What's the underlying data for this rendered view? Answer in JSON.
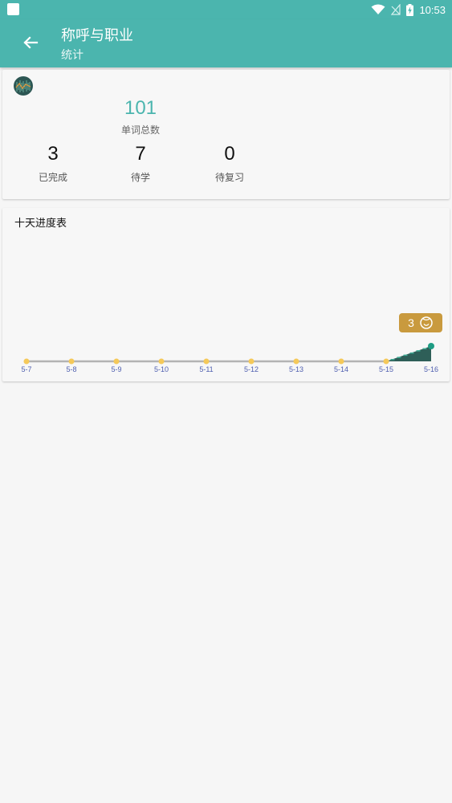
{
  "status_bar": {
    "time": "10:53",
    "icons": [
      "app-notification-icon",
      "wifi-icon",
      "no-signal-icon",
      "battery-charging-icon"
    ]
  },
  "app_bar": {
    "title": "称呼与职业",
    "subtitle": "统计",
    "back_icon": "arrow-left-icon"
  },
  "summary": {
    "total_value": "101",
    "total_label": "单词总数",
    "stats": [
      {
        "value": "3",
        "label": "已完成"
      },
      {
        "value": "7",
        "label": "待学"
      },
      {
        "value": "0",
        "label": "待复习"
      }
    ]
  },
  "progress_card": {
    "title": "十天进度表"
  },
  "chart_data": {
    "type": "area",
    "x": [
      "5-7",
      "5-8",
      "5-9",
      "5-10",
      "5-11",
      "5-12",
      "5-13",
      "5-14",
      "5-15",
      "5-16"
    ],
    "values": [
      0,
      0,
      0,
      0,
      0,
      0,
      0,
      0,
      0,
      3
    ],
    "tooltip": {
      "x": "5-16",
      "value": "3",
      "icon": "smiley-face-icon"
    },
    "colors": {
      "line": "#b3b3b3",
      "point": "#f5c95a",
      "area": "#2e5f58",
      "last_point": "#1e9c84",
      "tooltip": "#c99a3e",
      "tick": "#5060b0"
    }
  },
  "colors": {
    "primary": "#4bb5ae"
  }
}
